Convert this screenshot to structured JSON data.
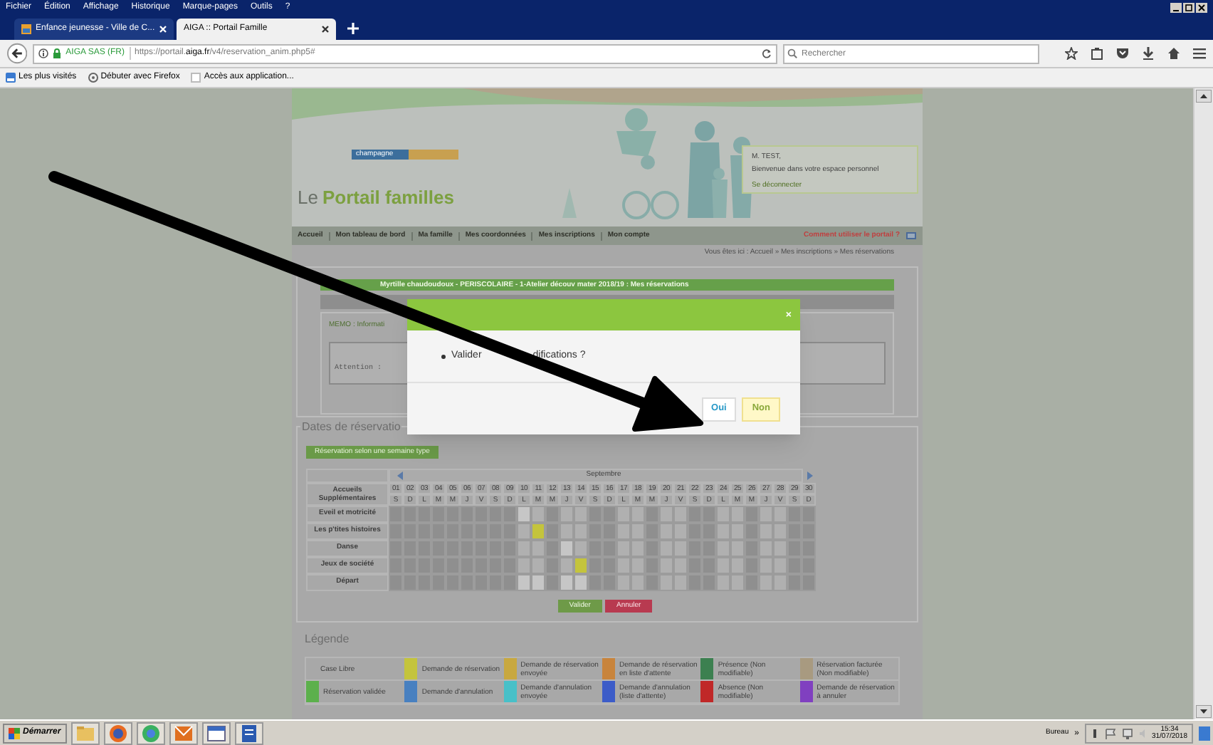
{
  "browser": {
    "menu": [
      "Fichier",
      "Édition",
      "Affichage",
      "Historique",
      "Marque-pages",
      "Outils",
      "?"
    ],
    "tabs": [
      {
        "label": "Enfance jeunesse - Ville de C...",
        "selected": false
      },
      {
        "label": "AIGA :: Portail Famille",
        "selected": true
      }
    ],
    "site_identity": "AIGA SAS (FR)",
    "url": "https://portail.**aiga.fr**/v4/reservation_anim.php5#",
    "search": {
      "placeholder": "Rechercher"
    },
    "bookmarks": [
      "Les plus visités",
      "Débuter avec Firefox",
      "Accès aux application..."
    ]
  },
  "header": {
    "logo_badge": "champagne",
    "title_prefix": "Le",
    "title": "Portail familles",
    "welcome": {
      "name": "M. TEST,",
      "message": "Bienvenue dans votre espace personnel",
      "logout": "Se déconnecter"
    }
  },
  "nav": {
    "items": [
      "Accueil",
      "Mon tableau de bord",
      "Ma famille",
      "Mes coordonnées",
      "Mes inscriptions",
      "Mon compte"
    ],
    "help": "Comment utiliser le portail ?"
  },
  "breadcrumb": "Vous êtes ici : Accueil » Mes inscriptions » Mes réservations",
  "reservation": {
    "title": "Myrtille chaudoudoux - PERISCOLAIRE - 1-Atelier découv mater 2018/19 : Mes réservations",
    "memo_label": "MEMO : Informati",
    "memo_text": "Attention :"
  },
  "dialog": {
    "close": "×",
    "message": [
      "Valider",
      "difications ?"
    ],
    "buttons": [
      {
        "label": "Oui",
        "kind": "primary"
      },
      {
        "label": "Non",
        "kind": "secondary"
      }
    ]
  },
  "dates": {
    "legend": "Dates de réservatio",
    "week_button": "Réservation selon une semaine type",
    "month": "Septembre",
    "row_header": "Accueils Supplémentaires",
    "days": [
      {
        "num": "01",
        "letter": "S"
      },
      {
        "num": "02",
        "letter": "D"
      },
      {
        "num": "03",
        "letter": "L"
      },
      {
        "num": "04",
        "letter": "M"
      },
      {
        "num": "05",
        "letter": "M"
      },
      {
        "num": "06",
        "letter": "J"
      },
      {
        "num": "07",
        "letter": "V"
      },
      {
        "num": "08",
        "letter": "S"
      },
      {
        "num": "09",
        "letter": "D"
      },
      {
        "num": "10",
        "letter": "L"
      },
      {
        "num": "11",
        "letter": "M"
      },
      {
        "num": "12",
        "letter": "M"
      },
      {
        "num": "13",
        "letter": "J"
      },
      {
        "num": "14",
        "letter": "V"
      },
      {
        "num": "15",
        "letter": "S"
      },
      {
        "num": "16",
        "letter": "D"
      },
      {
        "num": "17",
        "letter": "L"
      },
      {
        "num": "18",
        "letter": "M"
      },
      {
        "num": "19",
        "letter": "M"
      },
      {
        "num": "20",
        "letter": "J"
      },
      {
        "num": "21",
        "letter": "V"
      },
      {
        "num": "22",
        "letter": "S"
      },
      {
        "num": "23",
        "letter": "D"
      },
      {
        "num": "24",
        "letter": "L"
      },
      {
        "num": "25",
        "letter": "M"
      },
      {
        "num": "26",
        "letter": "M"
      },
      {
        "num": "27",
        "letter": "J"
      },
      {
        "num": "28",
        "letter": "V"
      },
      {
        "num": "29",
        "letter": "S"
      },
      {
        "num": "30",
        "letter": "D"
      }
    ],
    "activities": [
      {
        "name": "Eveil et motricité",
        "cells": [
          {
            "color": "#8f8f8f"
          },
          {
            "color": "#8f8f8f"
          },
          {
            "color": "#8f8f8f"
          },
          {
            "color": "#8f8f8f"
          },
          {
            "color": "#8f8f8f"
          },
          {
            "color": "#8f8f8f"
          },
          {
            "color": "#8f8f8f"
          },
          {
            "color": "#8f8f8f"
          },
          {
            "color": "#8f8f8f"
          },
          {
            "color": "#c6c6c6"
          },
          {
            "color": "#b0b0b0"
          },
          {
            "color": "#8f8f8f"
          },
          {
            "color": "#b0b0b0"
          },
          {
            "color": "#b0b0b0"
          },
          {
            "color": "#8f8f8f"
          },
          {
            "color": "#8f8f8f"
          },
          {
            "color": "#b0b0b0"
          },
          {
            "color": "#b0b0b0"
          },
          {
            "color": "#8f8f8f"
          },
          {
            "color": "#b0b0b0"
          },
          {
            "color": "#b0b0b0"
          },
          {
            "color": "#8f8f8f"
          },
          {
            "color": "#8f8f8f"
          },
          {
            "color": "#b0b0b0"
          },
          {
            "color": "#b0b0b0"
          },
          {
            "color": "#8f8f8f"
          },
          {
            "color": "#b0b0b0"
          },
          {
            "color": "#b0b0b0"
          },
          {
            "color": "#8f8f8f"
          },
          {
            "color": "#8f8f8f"
          }
        ]
      },
      {
        "name": "Les p'tites histoires",
        "cells": [
          {
            "color": "#8f8f8f"
          },
          {
            "color": "#8f8f8f"
          },
          {
            "color": "#8f8f8f"
          },
          {
            "color": "#8f8f8f"
          },
          {
            "color": "#8f8f8f"
          },
          {
            "color": "#8f8f8f"
          },
          {
            "color": "#8f8f8f"
          },
          {
            "color": "#8f8f8f"
          },
          {
            "color": "#8f8f8f"
          },
          {
            "color": "#b0b0b0"
          },
          {
            "color": "#c4c43c"
          },
          {
            "color": "#8f8f8f"
          },
          {
            "color": "#b0b0b0"
          },
          {
            "color": "#b0b0b0"
          },
          {
            "color": "#8f8f8f"
          },
          {
            "color": "#8f8f8f"
          },
          {
            "color": "#b0b0b0"
          },
          {
            "color": "#b0b0b0"
          },
          {
            "color": "#8f8f8f"
          },
          {
            "color": "#b0b0b0"
          },
          {
            "color": "#b0b0b0"
          },
          {
            "color": "#8f8f8f"
          },
          {
            "color": "#8f8f8f"
          },
          {
            "color": "#b0b0b0"
          },
          {
            "color": "#b0b0b0"
          },
          {
            "color": "#8f8f8f"
          },
          {
            "color": "#b0b0b0"
          },
          {
            "color": "#b0b0b0"
          },
          {
            "color": "#8f8f8f"
          },
          {
            "color": "#8f8f8f"
          }
        ]
      },
      {
        "name": "Danse",
        "cells": [
          {
            "color": "#8f8f8f"
          },
          {
            "color": "#8f8f8f"
          },
          {
            "color": "#8f8f8f"
          },
          {
            "color": "#8f8f8f"
          },
          {
            "color": "#8f8f8f"
          },
          {
            "color": "#8f8f8f"
          },
          {
            "color": "#8f8f8f"
          },
          {
            "color": "#8f8f8f"
          },
          {
            "color": "#8f8f8f"
          },
          {
            "color": "#b0b0b0"
          },
          {
            "color": "#b0b0b0"
          },
          {
            "color": "#8f8f8f"
          },
          {
            "color": "#c6c6c6"
          },
          {
            "color": "#b0b0b0"
          },
          {
            "color": "#8f8f8f"
          },
          {
            "color": "#8f8f8f"
          },
          {
            "color": "#b0b0b0"
          },
          {
            "color": "#b0b0b0"
          },
          {
            "color": "#8f8f8f"
          },
          {
            "color": "#b0b0b0"
          },
          {
            "color": "#b0b0b0"
          },
          {
            "color": "#8f8f8f"
          },
          {
            "color": "#8f8f8f"
          },
          {
            "color": "#b0b0b0"
          },
          {
            "color": "#b0b0b0"
          },
          {
            "color": "#8f8f8f"
          },
          {
            "color": "#b0b0b0"
          },
          {
            "color": "#b0b0b0"
          },
          {
            "color": "#8f8f8f"
          },
          {
            "color": "#8f8f8f"
          }
        ]
      },
      {
        "name": "Jeux de société",
        "cells": [
          {
            "color": "#8f8f8f"
          },
          {
            "color": "#8f8f8f"
          },
          {
            "color": "#8f8f8f"
          },
          {
            "color": "#8f8f8f"
          },
          {
            "color": "#8f8f8f"
          },
          {
            "color": "#8f8f8f"
          },
          {
            "color": "#8f8f8f"
          },
          {
            "color": "#8f8f8f"
          },
          {
            "color": "#8f8f8f"
          },
          {
            "color": "#b0b0b0"
          },
          {
            "color": "#b0b0b0"
          },
          {
            "color": "#8f8f8f"
          },
          {
            "color": "#b0b0b0"
          },
          {
            "color": "#c4c43c"
          },
          {
            "color": "#8f8f8f"
          },
          {
            "color": "#8f8f8f"
          },
          {
            "color": "#b0b0b0"
          },
          {
            "color": "#b0b0b0"
          },
          {
            "color": "#8f8f8f"
          },
          {
            "color": "#b0b0b0"
          },
          {
            "color": "#b0b0b0"
          },
          {
            "color": "#8f8f8f"
          },
          {
            "color": "#8f8f8f"
          },
          {
            "color": "#b0b0b0"
          },
          {
            "color": "#b0b0b0"
          },
          {
            "color": "#8f8f8f"
          },
          {
            "color": "#b0b0b0"
          },
          {
            "color": "#b0b0b0"
          },
          {
            "color": "#8f8f8f"
          },
          {
            "color": "#8f8f8f"
          }
        ]
      },
      {
        "name": "Départ",
        "cells": [
          {
            "color": "#8f8f8f"
          },
          {
            "color": "#8f8f8f"
          },
          {
            "color": "#8f8f8f"
          },
          {
            "color": "#8f8f8f"
          },
          {
            "color": "#8f8f8f"
          },
          {
            "color": "#8f8f8f"
          },
          {
            "color": "#8f8f8f"
          },
          {
            "color": "#8f8f8f"
          },
          {
            "color": "#8f8f8f"
          },
          {
            "color": "#c6c6c6"
          },
          {
            "color": "#c6c6c6"
          },
          {
            "color": "#8f8f8f"
          },
          {
            "color": "#c6c6c6"
          },
          {
            "color": "#c6c6c6"
          },
          {
            "color": "#8f8f8f"
          },
          {
            "color": "#8f8f8f"
          },
          {
            "color": "#b0b0b0"
          },
          {
            "color": "#b0b0b0"
          },
          {
            "color": "#8f8f8f"
          },
          {
            "color": "#b0b0b0"
          },
          {
            "color": "#b0b0b0"
          },
          {
            "color": "#8f8f8f"
          },
          {
            "color": "#8f8f8f"
          },
          {
            "color": "#b0b0b0"
          },
          {
            "color": "#b0b0b0"
          },
          {
            "color": "#8f8f8f"
          },
          {
            "color": "#b0b0b0"
          },
          {
            "color": "#b0b0b0"
          },
          {
            "color": "#8f8f8f"
          },
          {
            "color": "#8f8f8f"
          }
        ]
      }
    ],
    "actions": [
      {
        "label": "Valider",
        "kind": "confirm"
      },
      {
        "label": "Annuler",
        "kind": "cancel"
      }
    ]
  },
  "legend": {
    "title": "Légende",
    "items": [
      {
        "label": "Case Libre"
      },
      {
        "label": "Demande de réservation",
        "color": "#c4c43c"
      },
      {
        "label": "Demande de réservation envoyée",
        "color": "#c8a840"
      },
      {
        "label": "Demande de réservation en liste d'attente",
        "color": "#c8843c"
      },
      {
        "label": "Présence (Non modifiable)",
        "color": "#3c8050"
      },
      {
        "label": "Réservation facturée (Non modifiable)",
        "color": "#a89a80"
      },
      {
        "label": "Réservation validée",
        "color": "#5cb04c"
      },
      {
        "label": "Demande d'annulation",
        "color": "#4880c0"
      },
      {
        "label": "Demande d'annulation envoyée",
        "color": "#48c0c8"
      },
      {
        "label": "Demande d'annulation (liste d'attente)",
        "color": "#3c5cc8"
      },
      {
        "label": "Absence (Non modifiable)",
        "color": "#c02828"
      },
      {
        "label": "Demande de réservation à annuler",
        "color": "#8040c0"
      }
    ]
  },
  "taskbar": {
    "start": "Démarrer",
    "toolbar": "Bureau",
    "more": "»",
    "time": "15:34",
    "date": "31/07/2018"
  }
}
